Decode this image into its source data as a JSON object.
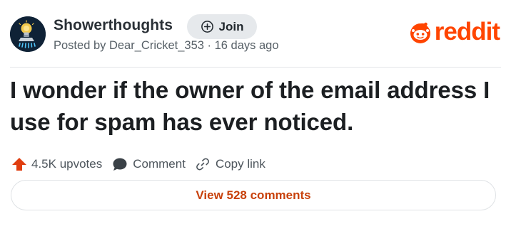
{
  "subreddit": {
    "name": "Showerthoughts",
    "icon": "showerhead-lightbulb-icon"
  },
  "join_button": {
    "label": "Join",
    "icon": "plus-circle-icon"
  },
  "post_meta": "Posted by Dear_Cricket_353 · 16 days ago",
  "brand": {
    "wordmark": "reddit",
    "color": "#ff4500"
  },
  "post": {
    "title": "I wonder if the owner of the email address I use for spam has ever noticed."
  },
  "actions": {
    "upvotes_label": "4.5K upvotes",
    "upvote_icon": "upvote-arrow-icon",
    "comment_label": "Comment",
    "comment_icon": "speech-bubble-icon",
    "copy_label": "Copy link",
    "copy_icon": "link-icon"
  },
  "view_comments": {
    "label": "View 528 comments",
    "color": "#c8410b"
  }
}
